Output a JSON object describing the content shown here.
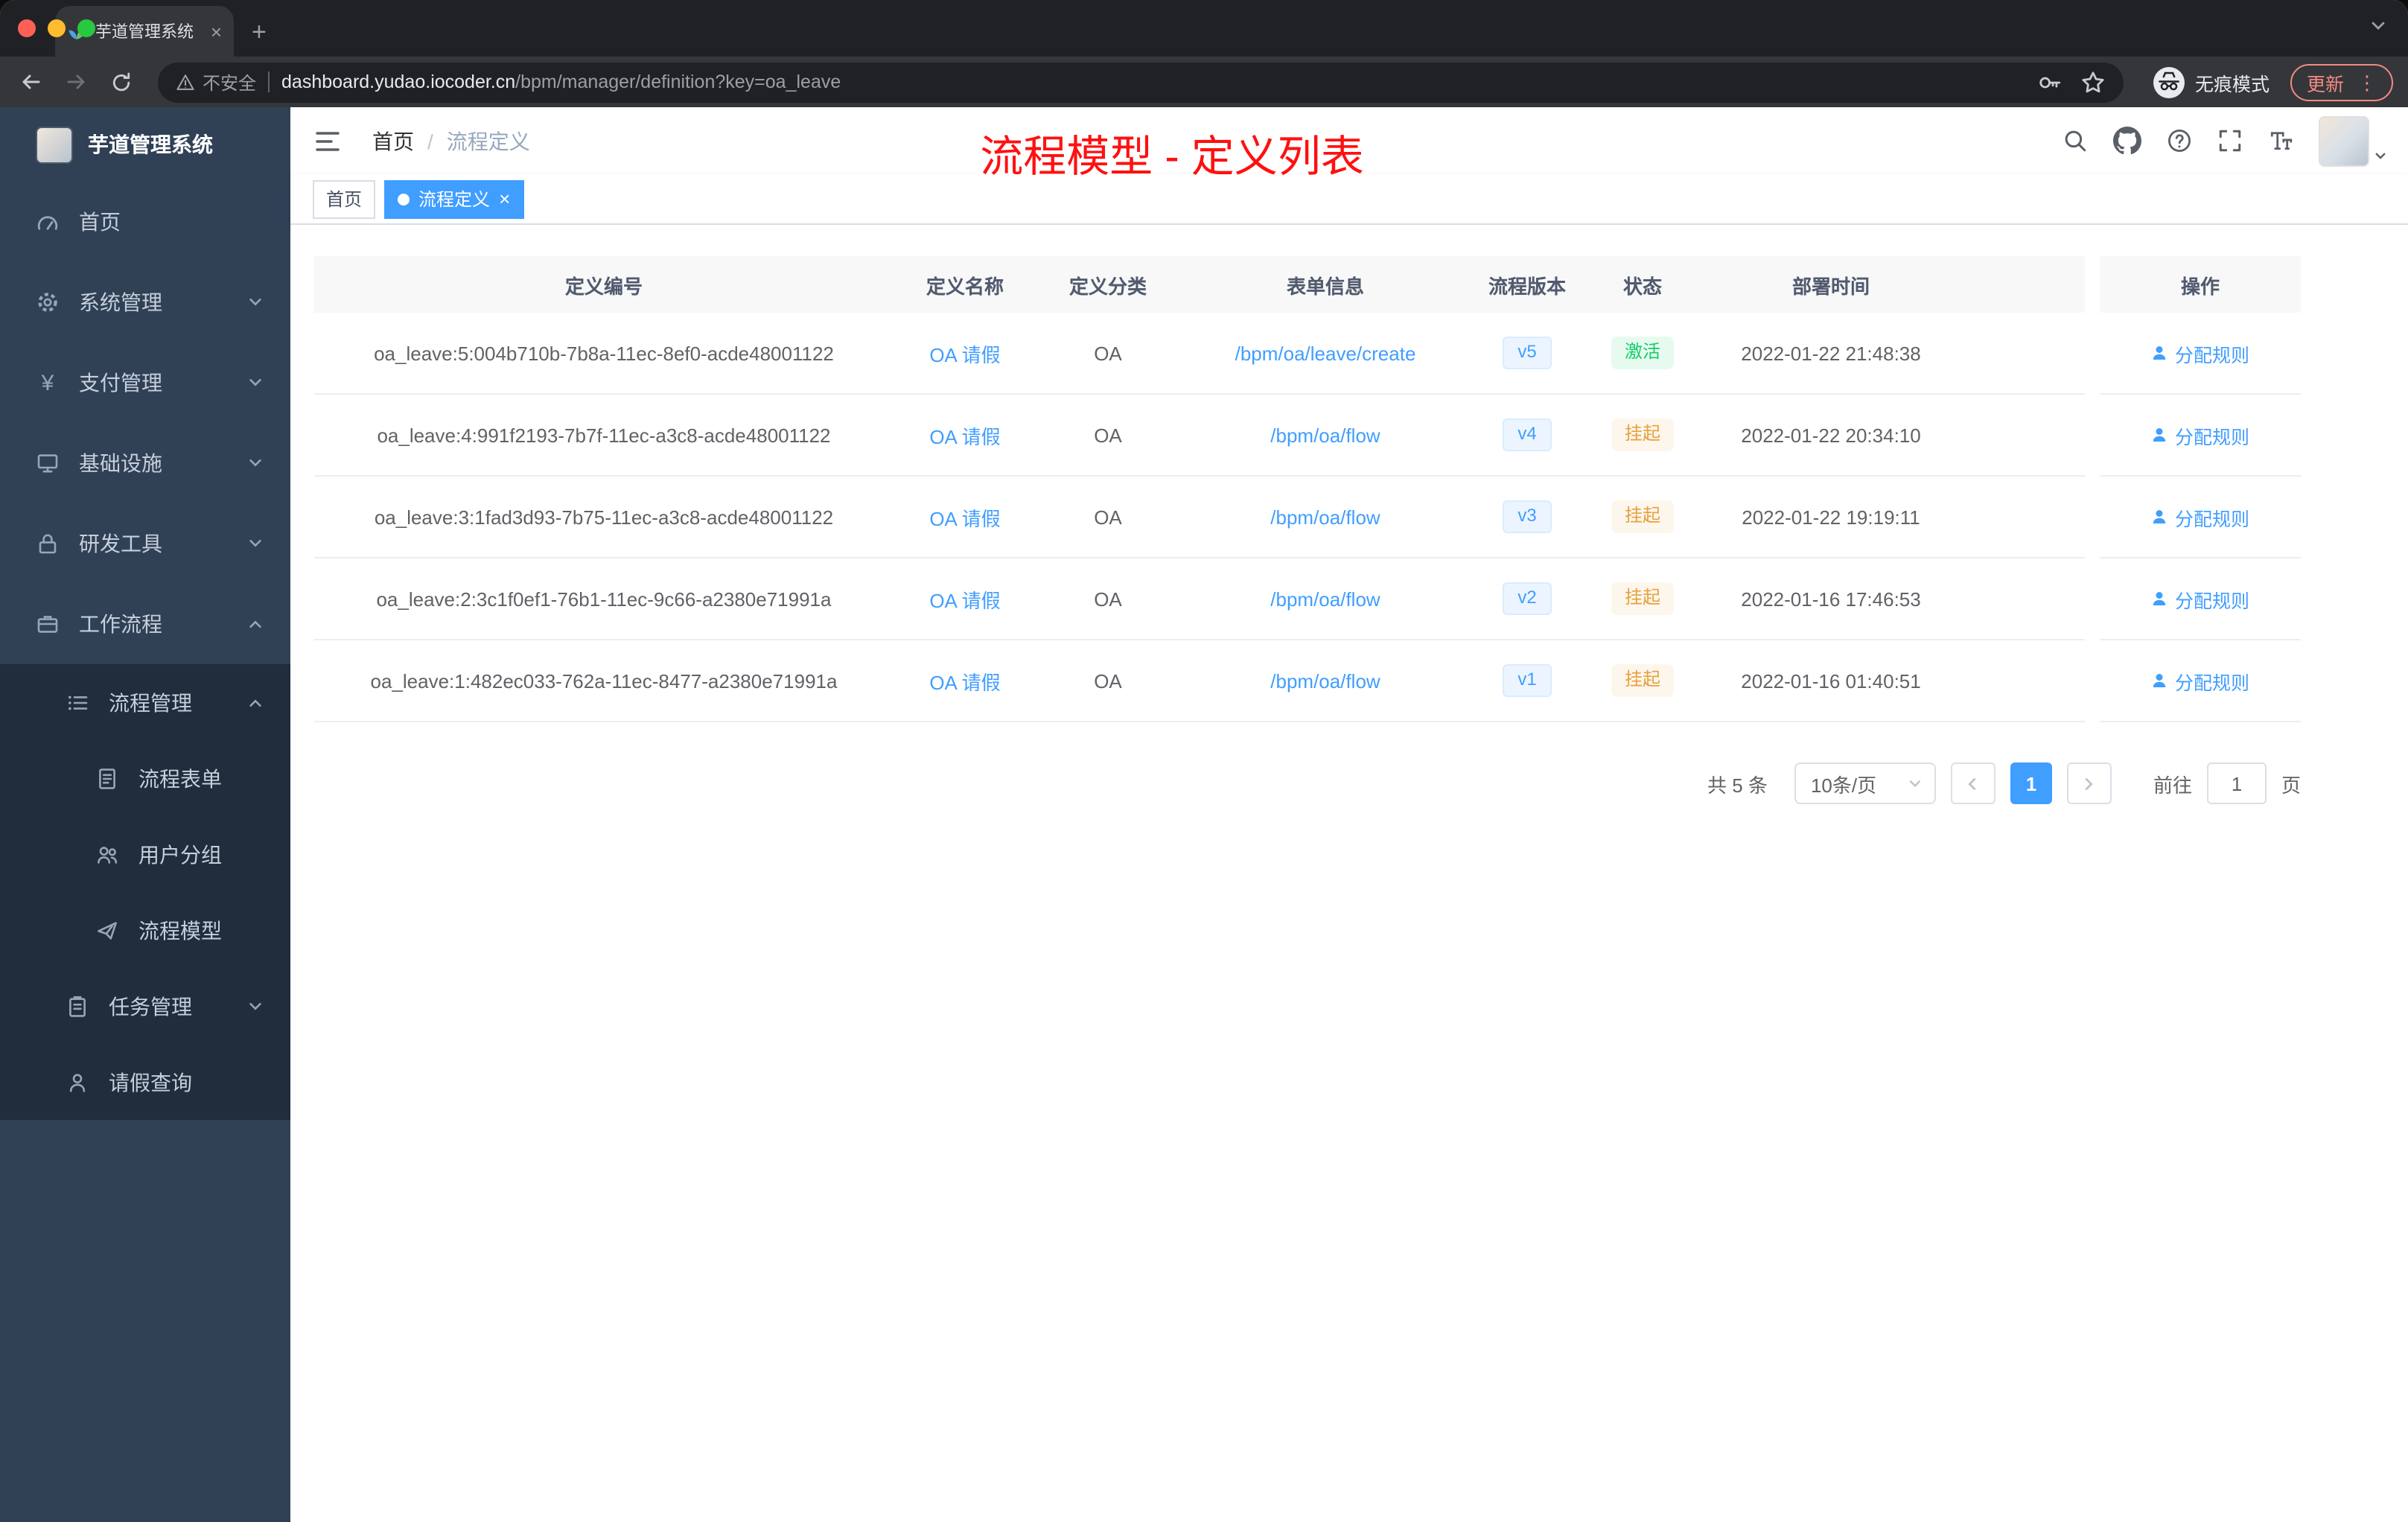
{
  "colors": {
    "accent": "#409eff",
    "success": "#13ce66",
    "warning": "#e6a23c",
    "annotation_red": "#ff1010",
    "sidebar_bg": "#304156",
    "sidebar_sub_bg": "#1f2d3d"
  },
  "browser": {
    "tab_title": "芋道管理系统",
    "security_label": "不安全",
    "url_host": "dashboard.yudao.iocoder.cn",
    "url_path": "/bpm/manager/definition?key=oa_leave",
    "incognito_label": "无痕模式",
    "update_label": "更新"
  },
  "sidebar": {
    "logo_title": "芋道管理系统",
    "items": [
      {
        "label": "首页"
      },
      {
        "label": "系统管理"
      },
      {
        "label": "支付管理"
      },
      {
        "label": "基础设施"
      },
      {
        "label": "研发工具"
      },
      {
        "label": "工作流程"
      }
    ],
    "submenu": {
      "process_management": "流程管理",
      "children": [
        {
          "label": "流程表单"
        },
        {
          "label": "用户分组"
        },
        {
          "label": "流程模型"
        }
      ],
      "task_management": "任务管理",
      "leave_query": "请假查询"
    }
  },
  "header": {
    "breadcrumb_home": "首页",
    "breadcrumb_current": "流程定义",
    "annotation": "流程模型 - 定义列表"
  },
  "tags": {
    "home": "首页",
    "current": "流程定义"
  },
  "table": {
    "columns": [
      "定义编号",
      "定义名称",
      "定义分类",
      "表单信息",
      "流程版本",
      "状态",
      "部署时间",
      "操作"
    ],
    "rows": [
      {
        "id": "oa_leave:5:004b710b-7b8a-11ec-8ef0-acde48001122",
        "name": "OA 请假",
        "category": "OA",
        "form": "/bpm/oa/leave/create",
        "version": "v5",
        "status": "激活",
        "deployed": "2022-01-22 21:48:38",
        "action": "分配规则"
      },
      {
        "id": "oa_leave:4:991f2193-7b7f-11ec-a3c8-acde48001122",
        "name": "OA 请假",
        "category": "OA",
        "form": "/bpm/oa/flow",
        "version": "v4",
        "status": "挂起",
        "deployed": "2022-01-22 20:34:10",
        "action": "分配规则"
      },
      {
        "id": "oa_leave:3:1fad3d93-7b75-11ec-a3c8-acde48001122",
        "name": "OA 请假",
        "category": "OA",
        "form": "/bpm/oa/flow",
        "version": "v3",
        "status": "挂起",
        "deployed": "2022-01-22 19:19:11",
        "action": "分配规则"
      },
      {
        "id": "oa_leave:2:3c1f0ef1-76b1-11ec-9c66-a2380e71991a",
        "name": "OA 请假",
        "category": "OA",
        "form": "/bpm/oa/flow",
        "version": "v2",
        "status": "挂起",
        "deployed": "2022-01-16 17:46:53",
        "action": "分配规则"
      },
      {
        "id": "oa_leave:1:482ec033-762a-11ec-8477-a2380e71991a",
        "name": "OA 请假",
        "category": "OA",
        "form": "/bpm/oa/flow",
        "version": "v1",
        "status": "挂起",
        "deployed": "2022-01-16 01:40:51",
        "action": "分配规则"
      }
    ]
  },
  "pagination": {
    "total": "共 5 条",
    "page_size": "10条/页",
    "current_page": "1",
    "goto_label": "前往",
    "goto_value": "1",
    "page_unit": "页"
  }
}
